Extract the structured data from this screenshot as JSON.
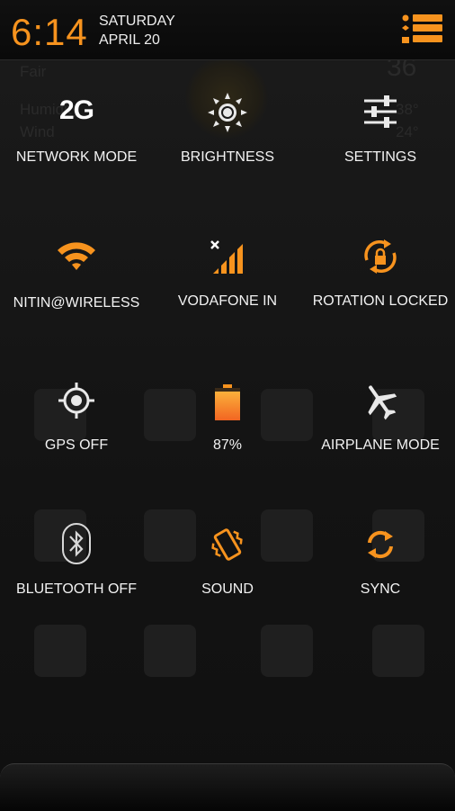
{
  "colors": {
    "accent": "#f7931e",
    "background": "#151515",
    "text": "#f2f2f2"
  },
  "header": {
    "time": "6:14",
    "day": "SATURDAY",
    "date": "APRIL 20",
    "menu_icon": "list-menu-icon"
  },
  "tiles": [
    {
      "label": "NETWORK MODE",
      "value": "2G",
      "icon": "network-mode-icon"
    },
    {
      "label": "BRIGHTNESS",
      "icon": "brightness-icon"
    },
    {
      "label": "SETTINGS",
      "icon": "settings-sliders-icon"
    },
    {
      "label": "NITIN@WIRELESS",
      "icon": "wifi-icon"
    },
    {
      "label": "VODAFONE IN",
      "icon": "cell-signal-icon"
    },
    {
      "label": "ROTATION LOCKED",
      "icon": "rotation-lock-icon"
    },
    {
      "label": "GPS OFF",
      "icon": "gps-icon"
    },
    {
      "label": "87%",
      "icon": "battery-icon"
    },
    {
      "label": "AIRPLANE MODE",
      "icon": "airplane-icon"
    },
    {
      "label": "BLUETOOTH OFF",
      "icon": "bluetooth-icon"
    },
    {
      "label": "SOUND",
      "icon": "vibrate-icon"
    },
    {
      "label": "SYNC",
      "icon": "sync-icon"
    }
  ]
}
